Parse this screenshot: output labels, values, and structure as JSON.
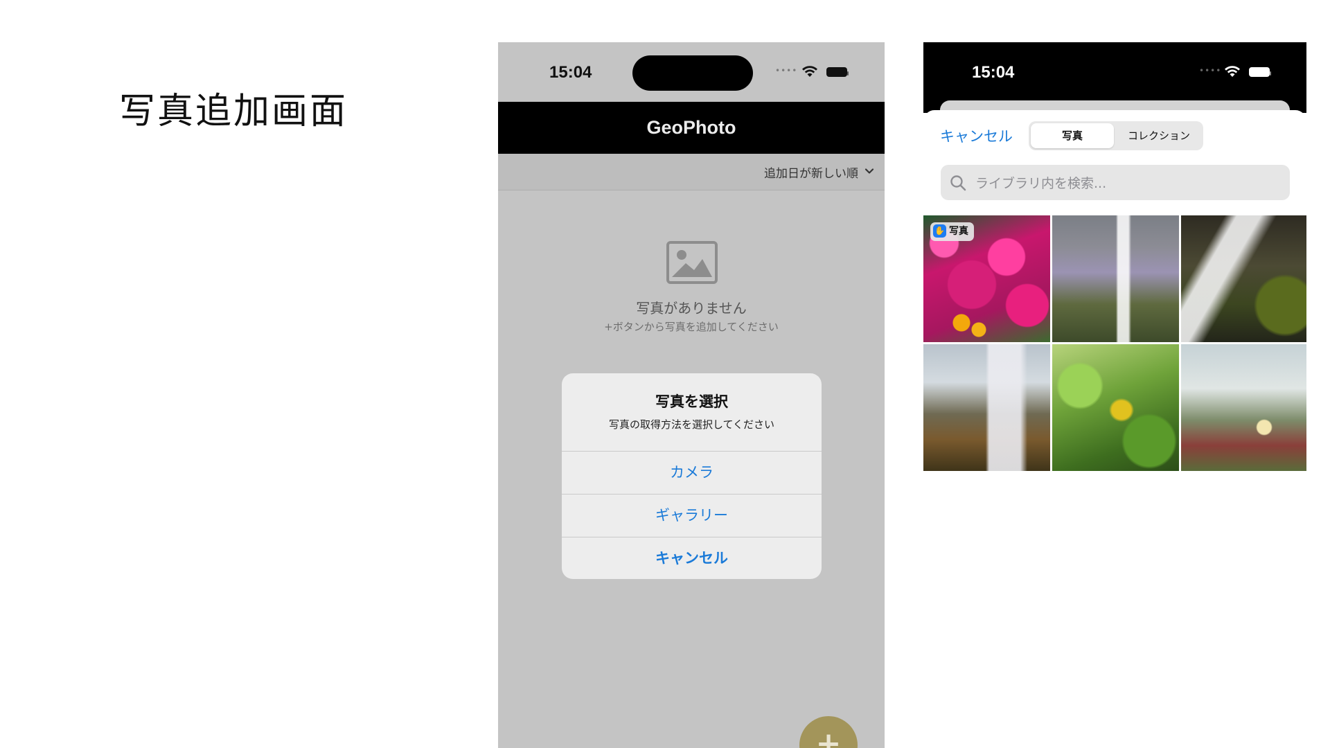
{
  "slide": {
    "title": "写真追加画面"
  },
  "phone_left": {
    "status": {
      "time": "15:04",
      "dots": "••••"
    },
    "app_title": "GeoPhoto",
    "sort": {
      "label": "追加日が新しい順"
    },
    "empty": {
      "title": "写真がありません",
      "subtitle": "+ボタンから写真を追加してください"
    },
    "alert": {
      "title": "写真を選択",
      "message": "写真の取得方法を選択してください",
      "buttons": [
        {
          "label": "カメラ"
        },
        {
          "label": "ギャラリー"
        },
        {
          "label": "キャンセル"
        }
      ]
    },
    "fab_label": "+",
    "colors": {
      "fab": "#a3955a",
      "link": "#1a7ad8"
    }
  },
  "phone_right": {
    "status": {
      "time": "15:04",
      "dots": "••••"
    },
    "cancel_label": "キャンセル",
    "segments": [
      {
        "label": "写真",
        "selected": true
      },
      {
        "label": "コレクション",
        "selected": false
      }
    ],
    "search": {
      "placeholder": "ライブラリ内を検索..."
    },
    "photos": [
      {
        "badge": "写真",
        "badge_icon": "hand-raised-icon"
      },
      {},
      {},
      {},
      {},
      {}
    ]
  }
}
